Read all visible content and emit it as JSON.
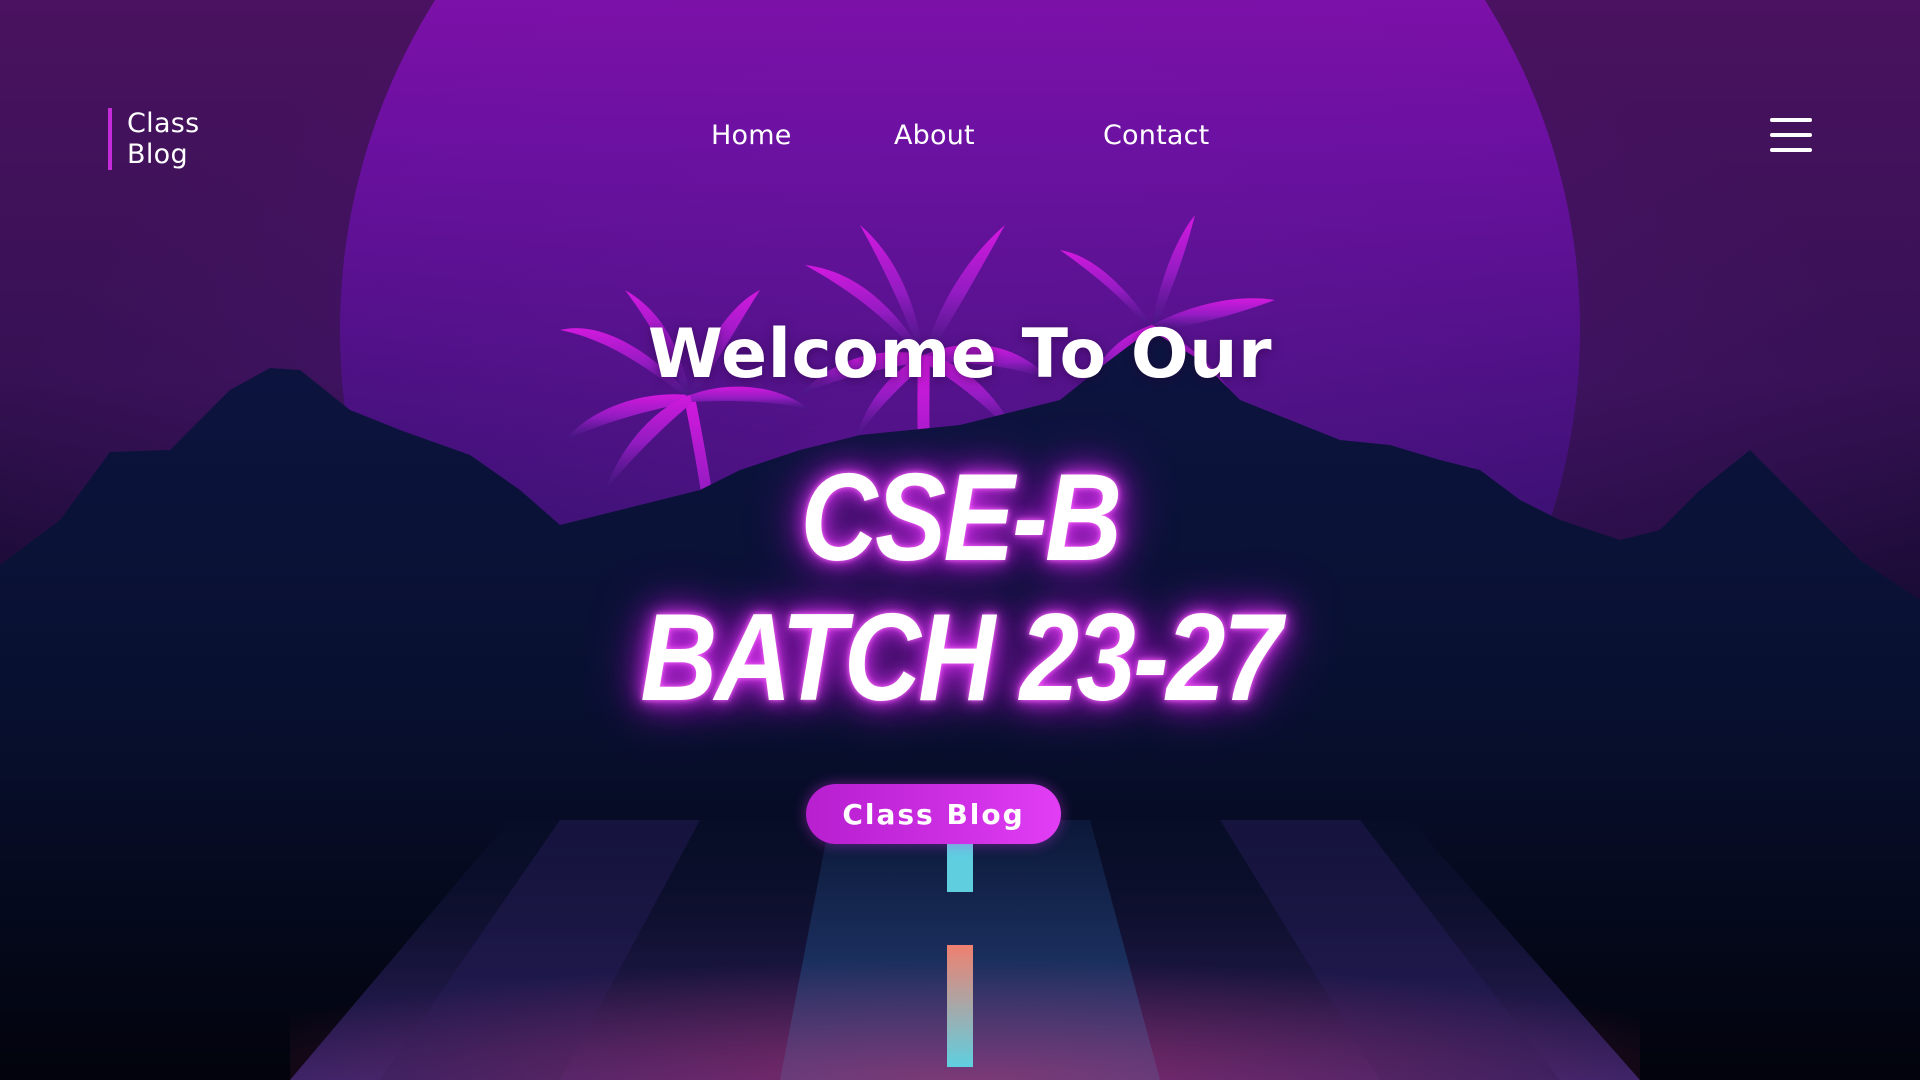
{
  "header": {
    "logo": {
      "line1": "Class",
      "line2": "Blog"
    },
    "nav": [
      {
        "label": "Home"
      },
      {
        "label": "About"
      },
      {
        "label": "Contact"
      }
    ],
    "menu_icon": "hamburger-menu-icon"
  },
  "hero": {
    "welcome": "Welcome To Our",
    "headline_line1": "CSE-B",
    "headline_line2": "BATCH 23-27",
    "cta_label": "Class Blog"
  },
  "background": {
    "icons": [
      "sun-glow",
      "palm-tree-icon",
      "mountain-range",
      "road-lane-marker"
    ]
  },
  "colors": {
    "accent": "#c62bd9",
    "button": "#d433e8",
    "glow": "#e13cf5",
    "sky_top": "#6a0f88",
    "mountains": "#0a1034",
    "lane_cyan": "#5fcfe0",
    "lane_coral": "#f08070"
  }
}
